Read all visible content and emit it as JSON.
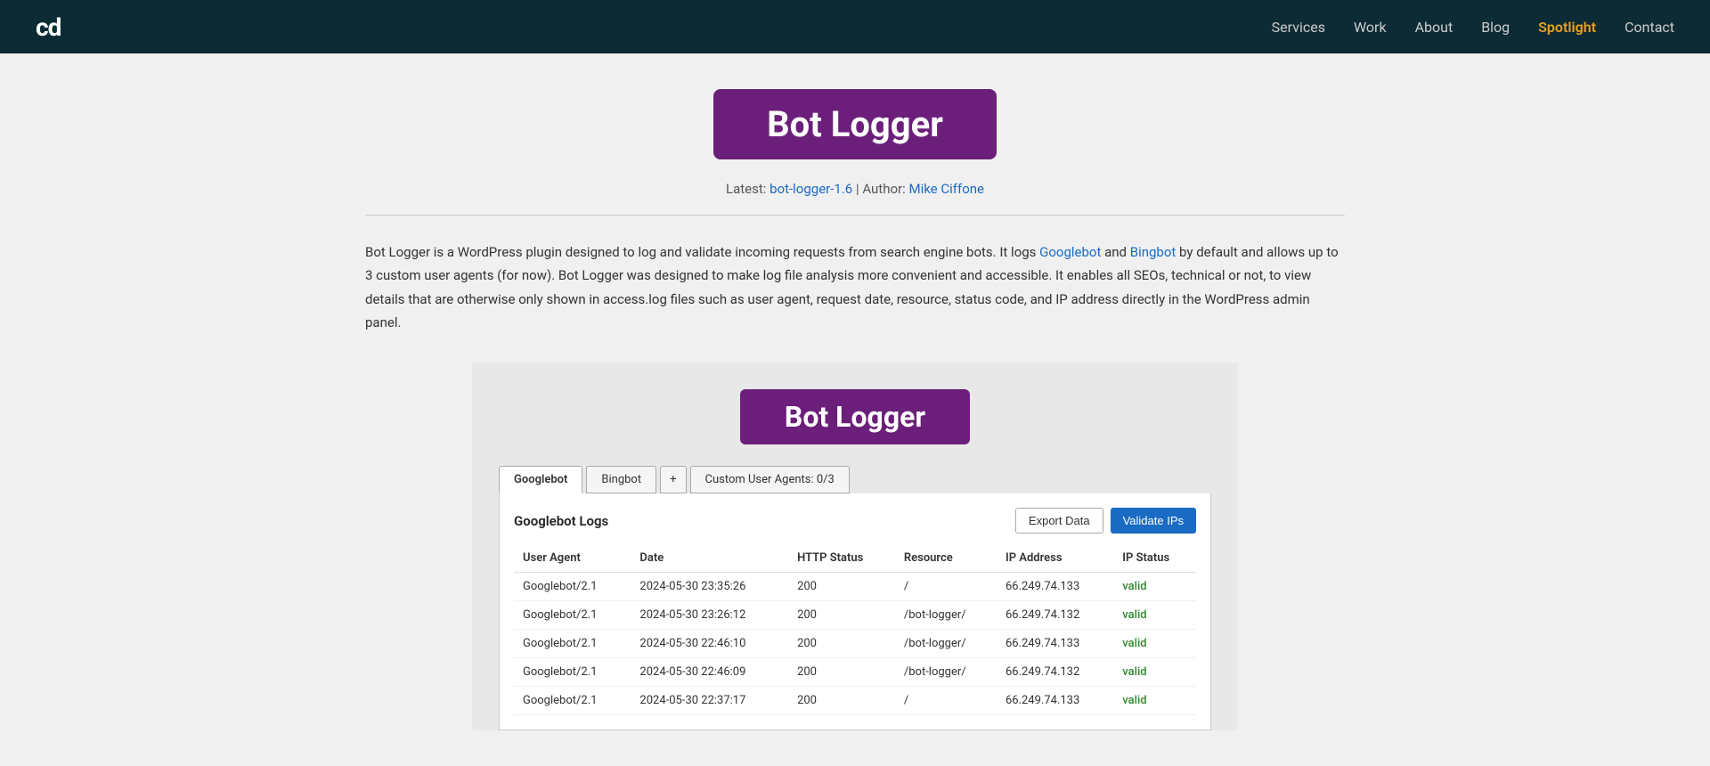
{
  "header": {
    "logo": "cd",
    "nav": [
      {
        "label": "Services",
        "active": false
      },
      {
        "label": "Work",
        "active": false
      },
      {
        "label": "About",
        "active": false
      },
      {
        "label": "Blog",
        "active": false
      },
      {
        "label": "Spotlight",
        "active": true
      },
      {
        "label": "Contact",
        "active": false
      }
    ]
  },
  "hero": {
    "title": "Bot Logger",
    "meta_latest_label": "Latest:",
    "meta_latest_link": "bot-logger-1.6",
    "meta_separator": "|",
    "meta_author_label": "Author:",
    "meta_author_link": "Mike Ciffone"
  },
  "description": {
    "text_1": "Bot Logger is a WordPress plugin designed to log and validate incoming requests from search engine bots. It logs ",
    "link_googlebot": "Googlebot",
    "text_2": " and ",
    "link_bingbot": "Bingbot",
    "text_3": " by default and allows up to 3 custom user agents (for now). Bot Logger was designed to make log file analysis more convenient and accessible. It enables all SEOs, technical or not, to view details that are otherwise only shown in access.log files such as user agent, request date, resource, status code, and IP address directly in the WordPress admin panel."
  },
  "preview": {
    "title": "Bot Logger",
    "tabs": [
      {
        "label": "Googlebot",
        "active": true
      },
      {
        "label": "Bingbot",
        "active": false
      },
      {
        "label": "+",
        "active": false,
        "is_plus": true
      },
      {
        "label": "Custom User Agents: 0/3",
        "active": false
      }
    ],
    "table_title": "Googlebot Logs",
    "btn_export": "Export Data",
    "btn_validate": "Validate IPs",
    "columns": [
      "User Agent",
      "Date",
      "HTTP Status",
      "Resource",
      "IP Address",
      "IP Status"
    ],
    "rows": [
      {
        "user_agent": "Googlebot/2.1",
        "date": "2024-05-30 23:35:26",
        "http_status": "200",
        "resource": "/",
        "ip_address": "66.249.74.133",
        "ip_status": "valid"
      },
      {
        "user_agent": "Googlebot/2.1",
        "date": "2024-05-30 23:26:12",
        "http_status": "200",
        "resource": "/bot-logger/",
        "ip_address": "66.249.74.132",
        "ip_status": "valid"
      },
      {
        "user_agent": "Googlebot/2.1",
        "date": "2024-05-30 22:46:10",
        "http_status": "200",
        "resource": "/bot-logger/",
        "ip_address": "66.249.74.133",
        "ip_status": "valid"
      },
      {
        "user_agent": "Googlebot/2.1",
        "date": "2024-05-30 22:46:09",
        "http_status": "200",
        "resource": "/bot-logger/",
        "ip_address": "66.249.74.132",
        "ip_status": "valid"
      },
      {
        "user_agent": "Googlebot/2.1",
        "date": "2024-05-30 22:37:17",
        "http_status": "200",
        "resource": "/",
        "ip_address": "66.249.74.133",
        "ip_status": "valid"
      }
    ]
  }
}
